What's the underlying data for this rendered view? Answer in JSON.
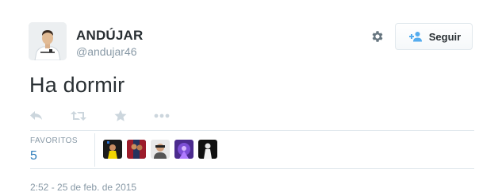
{
  "profile": {
    "fullname": "ANDÚJAR",
    "username": "@andujar46"
  },
  "follow_button": {
    "label": "Seguir"
  },
  "tweet": {
    "text": "Ha dormir"
  },
  "actions": {
    "icons": [
      "reply-icon",
      "retweet-icon",
      "favorite-star-icon",
      "more-dots-icon"
    ]
  },
  "stats": {
    "label": "FAVORITOS",
    "count": "5"
  },
  "favoriters": [
    {
      "name": "favoriter-1"
    },
    {
      "name": "favoriter-2"
    },
    {
      "name": "favoriter-3"
    },
    {
      "name": "favoriter-4"
    },
    {
      "name": "favoriter-5"
    }
  ],
  "timestamp": "2:52 - 25 de feb. de 2015",
  "colors": {
    "text": "#292f33",
    "muted": "#8899a6",
    "link": "#2b7bb9",
    "icon": "#ccd6dd",
    "follow_icon": "#55acee"
  }
}
